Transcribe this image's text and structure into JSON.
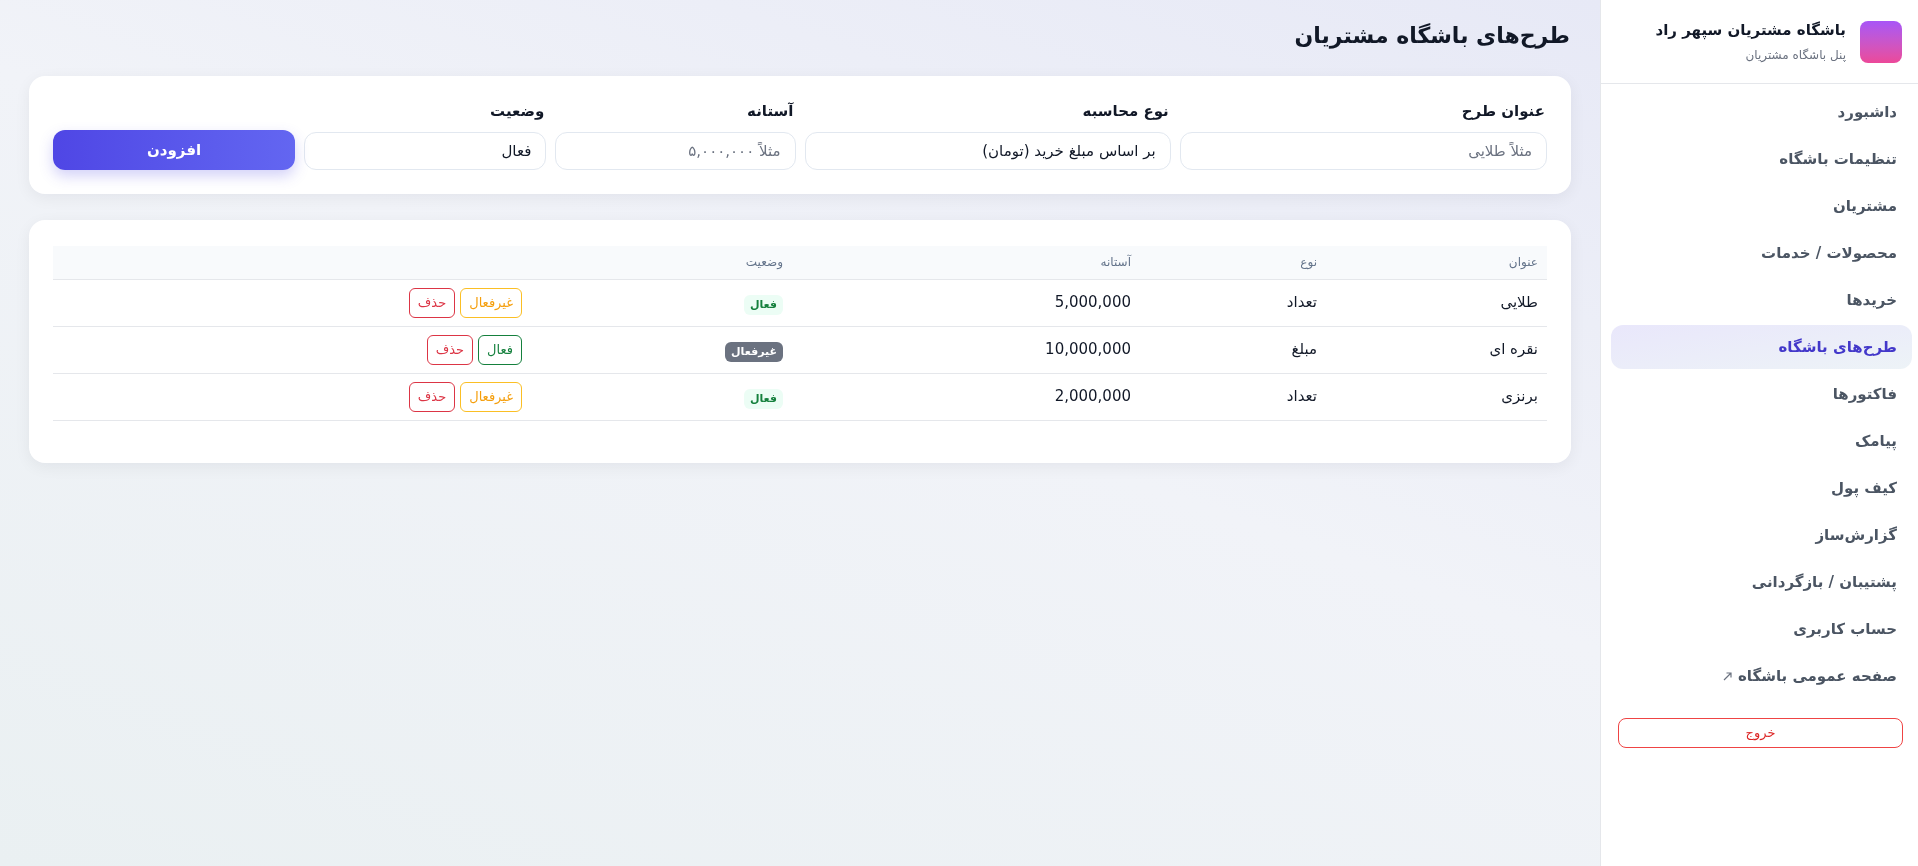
{
  "sidebar": {
    "title": "باشگاه مشتریان سپهر راد",
    "subtitle": "پنل باشگاه مشتریان",
    "items": [
      {
        "label": "داشبورد",
        "selected": false
      },
      {
        "label": "تنظیمات باشگاه",
        "selected": false
      },
      {
        "label": "مشتریان",
        "selected": false
      },
      {
        "label": "محصولات / خدمات",
        "selected": false
      },
      {
        "label": "خریدها",
        "selected": false
      },
      {
        "label": "طرح‌های باشگاه",
        "selected": true
      },
      {
        "label": "فاکتورها",
        "selected": false
      },
      {
        "label": "پیامک",
        "selected": false
      },
      {
        "label": "کیف پول",
        "selected": false
      },
      {
        "label": "گزارش‌ساز",
        "selected": false
      },
      {
        "label": "پشتیبان / بازگردانی",
        "selected": false
      },
      {
        "label": "حساب کاربری",
        "selected": false
      },
      {
        "label": "صفحه عمومی باشگاه",
        "selected": false,
        "external": true
      }
    ],
    "logout": "خروج"
  },
  "page": {
    "title": "طرح‌های باشگاه مشتریان"
  },
  "form": {
    "fields": [
      {
        "kind": "input",
        "label": "عنوان طرح",
        "placeholder": "مثلاً طلایی"
      },
      {
        "kind": "select",
        "label": "نوع محاسبه",
        "value": "بر اساس مبلغ خرید (تومان)"
      },
      {
        "kind": "input",
        "label": "آستانه",
        "placeholder": "مثلاً ۵,۰۰۰,۰۰۰"
      },
      {
        "kind": "select",
        "label": "وضعیت",
        "value": "فعال"
      }
    ],
    "submit": "افزودن"
  },
  "table": {
    "columns": [
      "عنوان",
      "نوع",
      "آستانه",
      "وضعیت"
    ],
    "rows": [
      {
        "title": "طلایی",
        "type": "تعداد",
        "threshold": "5,000,000",
        "status": {
          "label": "فعال",
          "active": true
        },
        "actions": [
          {
            "label": "غیرفعال",
            "kind": "deactivate"
          },
          {
            "label": "حذف",
            "kind": "delete"
          }
        ]
      },
      {
        "title": "نقره ای",
        "type": "مبلغ",
        "threshold": "10,000,000",
        "status": {
          "label": "غیرفعال",
          "active": false
        },
        "actions": [
          {
            "label": "فعال",
            "kind": "activate"
          },
          {
            "label": "حذف",
            "kind": "delete"
          }
        ]
      },
      {
        "title": "برنزی",
        "type": "تعداد",
        "threshold": "2,000,000",
        "status": {
          "label": "فعال",
          "active": true
        },
        "actions": [
          {
            "label": "غیرفعال",
            "kind": "deactivate"
          },
          {
            "label": "حذف",
            "kind": "delete"
          }
        ]
      }
    ]
  }
}
